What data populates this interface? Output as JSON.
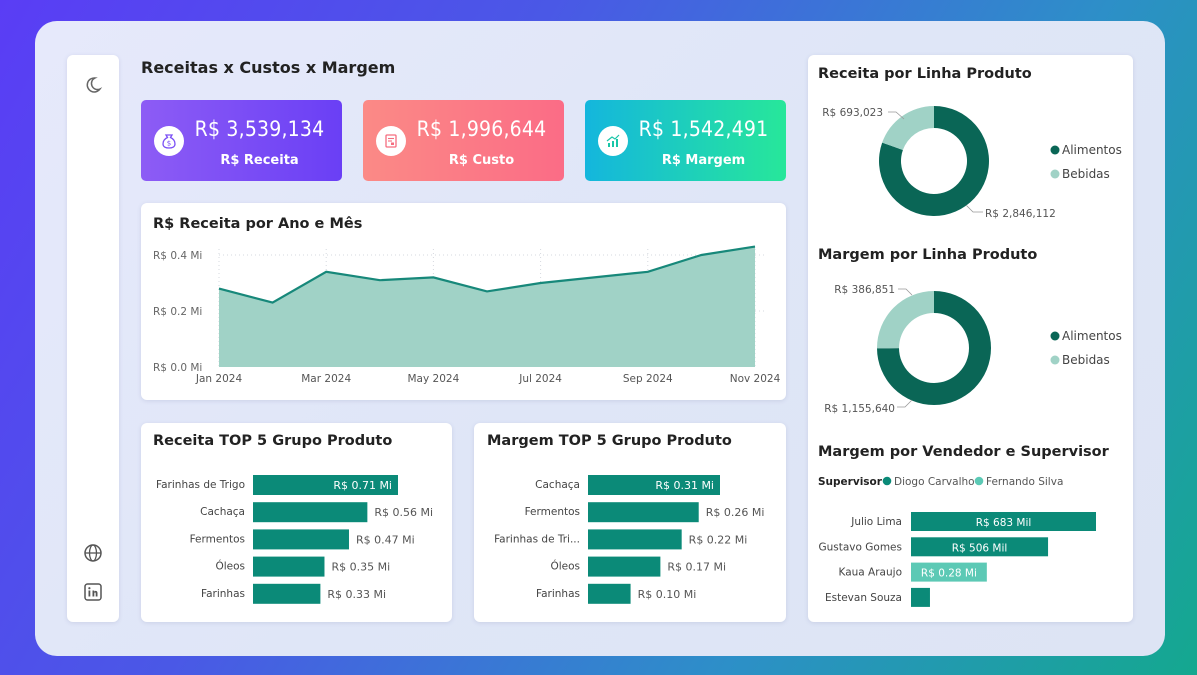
{
  "page_title": "Receitas x Custos x Margem",
  "nav": {
    "icons": [
      "moon-icon",
      "globe-icon",
      "linkedin-icon"
    ]
  },
  "kpis": [
    {
      "value": "R$ 3,539,134",
      "label": "R$ Receita",
      "icon": "money-bag-icon"
    },
    {
      "value": "R$ 1,996,644",
      "label": "R$ Custo",
      "icon": "invoice-icon"
    },
    {
      "value": "R$ 1,542,491",
      "label": "R$ Margem",
      "icon": "growth-chart-icon"
    }
  ],
  "colors": {
    "primary": "#0b8a78",
    "dark": "#0a6656",
    "light": "#a0d2c6",
    "alt_series": "#5cc9b5",
    "area_fill": "#a0d2c6",
    "line": "#17887a"
  },
  "charts": {
    "revenue_line": {
      "title": "R$ Receita por Ano e Mês"
    },
    "top5_revenue": {
      "title": "Receita TOP 5 Grupo Produto"
    },
    "top5_margin": {
      "title": "Margem TOP 5 Grupo Produto"
    },
    "donut_revenue": {
      "title": "Receita por Linha Produto"
    },
    "donut_margin": {
      "title": "Margem por Linha Produto"
    },
    "seller": {
      "title": "Margem por Vendedor e Supervisor",
      "legend_title": "Supervisor"
    }
  },
  "chart_data": [
    {
      "type": "area",
      "title": "R$ Receita por Ano e Mês",
      "x": [
        "Jan 2024",
        "Feb 2024",
        "Mar 2024",
        "Apr 2024",
        "May 2024",
        "Jun 2024",
        "Jul 2024",
        "Aug 2024",
        "Sep 2024",
        "Oct 2024",
        "Nov 2024"
      ],
      "x_tick_labels": [
        "Jan 2024",
        "Mar 2024",
        "May 2024",
        "Jul 2024",
        "Sep 2024",
        "Nov 2024"
      ],
      "values": [
        0.28,
        0.23,
        0.34,
        0.31,
        0.32,
        0.27,
        0.3,
        0.32,
        0.34,
        0.4,
        0.43
      ],
      "y_tick_labels": [
        "R$ 0.0 Mi",
        "R$ 0.2 Mi",
        "R$ 0.4 Mi"
      ],
      "ylim": [
        0,
        0.4
      ],
      "grid": true
    },
    {
      "type": "bar",
      "orientation": "horizontal",
      "title": "Receita TOP 5 Grupo Produto",
      "categories": [
        "Farinhas de Trigo",
        "Cachaça",
        "Fermentos",
        "Óleos",
        "Farinhas"
      ],
      "values": [
        0.71,
        0.56,
        0.47,
        0.35,
        0.33
      ],
      "labels": [
        "R$ 0.71 Mi",
        "R$ 0.56 Mi",
        "R$ 0.47 Mi",
        "R$ 0.35 Mi",
        "R$ 0.33 Mi"
      ]
    },
    {
      "type": "bar",
      "orientation": "horizontal",
      "title": "Margem TOP 5 Grupo Produto",
      "categories": [
        "Cachaça",
        "Fermentos",
        "Farinhas de Tri...",
        "Óleos",
        "Farinhas"
      ],
      "values": [
        0.31,
        0.26,
        0.22,
        0.17,
        0.1
      ],
      "labels": [
        "R$ 0.31 Mi",
        "R$ 0.26 Mi",
        "R$ 0.22 Mi",
        "R$ 0.17 Mi",
        "R$ 0.10 Mi"
      ]
    },
    {
      "type": "pie",
      "donut": true,
      "title": "Receita por Linha Produto",
      "categories": [
        "Alimentos",
        "Bebidas"
      ],
      "values": [
        2846112,
        693023
      ],
      "labels": [
        "R$ 2,846,112",
        "R$ 693,023"
      ],
      "legend": "right"
    },
    {
      "type": "pie",
      "donut": true,
      "title": "Margem por Linha Produto",
      "categories": [
        "Alimentos",
        "Bebidas"
      ],
      "values": [
        1155640,
        386851
      ],
      "labels": [
        "R$ 1,155,640",
        "R$ 386,851"
      ],
      "legend": "right"
    },
    {
      "type": "bar",
      "orientation": "horizontal",
      "title": "Margem por Vendedor e Supervisor",
      "categories": [
        "Julio Lima",
        "Gustavo Gomes",
        "Kaua Araujo",
        "Estevan Souza"
      ],
      "values": [
        683,
        506,
        280,
        70
      ],
      "labels": [
        "R$ 683 Mil",
        "R$ 506 Mil",
        "R$ 0.28 Mi",
        ""
      ],
      "supervisor": [
        "Diogo Carvalho",
        "Diogo Carvalho",
        "Fernando Silva",
        "Diogo Carvalho"
      ],
      "legend_title": "Supervisor",
      "series": [
        {
          "name": "Diogo Carvalho"
        },
        {
          "name": "Fernando Silva"
        }
      ]
    }
  ]
}
